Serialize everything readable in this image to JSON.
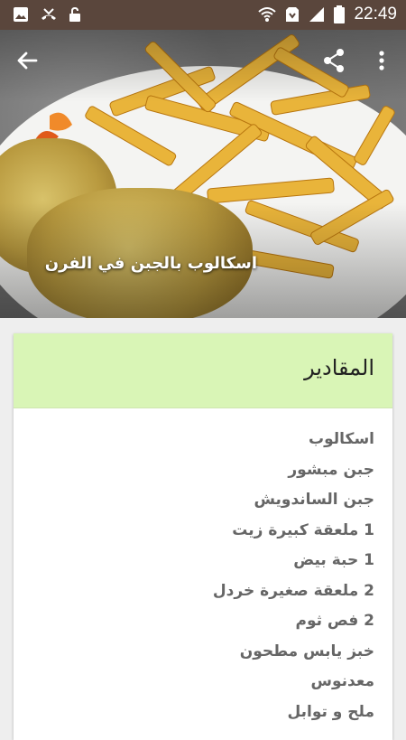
{
  "status_bar": {
    "time": "22:49",
    "left_icons": [
      "image-icon",
      "missed-call-icon",
      "unlock-icon"
    ],
    "right_icons": [
      "wifi-icon",
      "data-saver-icon",
      "signal-icon",
      "battery-icon"
    ]
  },
  "hero": {
    "title": "اسكالوب بالجبن في الفرن",
    "actions": [
      "back-arrow-icon",
      "share-icon",
      "more-vert-icon"
    ]
  },
  "card": {
    "title": "المقادير",
    "header_color": "#d9f5b6",
    "ingredients": [
      "اسكالوب",
      "جبن مبشور",
      "جبن الساندويش",
      "1 ملعقة كبيرة زيت",
      "1 حبة بيض",
      "2 ملعقة صغيرة خردل",
      "2 فص ثوم",
      "خبز يابس مطحون",
      "معدنوس",
      "ملح و توابل"
    ]
  },
  "colors": {
    "status_bar": "#5a463c",
    "background": "#eeeeee"
  }
}
